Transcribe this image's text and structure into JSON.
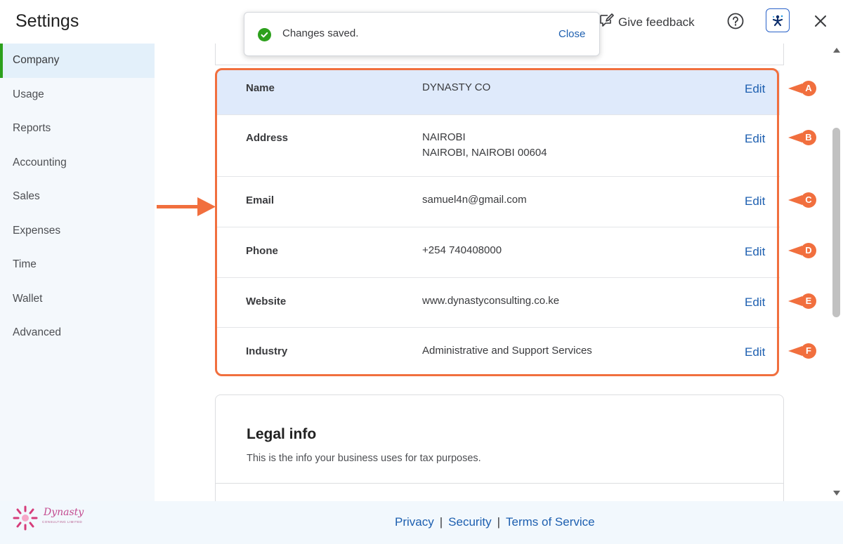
{
  "header": {
    "title": "Settings",
    "feedback_label": "Give feedback"
  },
  "toast": {
    "message": "Changes saved.",
    "close_label": "Close"
  },
  "sidebar": {
    "items": [
      {
        "label": "Company",
        "active": true
      },
      {
        "label": "Usage"
      },
      {
        "label": "Reports"
      },
      {
        "label": "Accounting"
      },
      {
        "label": "Sales"
      },
      {
        "label": "Expenses"
      },
      {
        "label": "Time"
      },
      {
        "label": "Wallet"
      },
      {
        "label": "Advanced"
      }
    ]
  },
  "company": {
    "edit_label": "Edit",
    "rows": [
      {
        "label": "Name",
        "value": "DYNASTY CO",
        "callout": "A"
      },
      {
        "label": "Address",
        "value_line1": "NAIROBI",
        "value_line2": "NAIROBI, NAIROBI 00604",
        "callout": "B"
      },
      {
        "label": "Email",
        "value": "samuel4n@gmail.com",
        "callout": "C"
      },
      {
        "label": "Phone",
        "value": "+254 740408000",
        "callout": "D"
      },
      {
        "label": "Website",
        "value": "www.dynastyconsulting.co.ke",
        "callout": "E"
      },
      {
        "label": "Industry",
        "value": "Administrative and Support Services",
        "callout": "F"
      }
    ]
  },
  "legal": {
    "title": "Legal info",
    "description": "This is the info your business uses for tax purposes."
  },
  "footer": {
    "links": [
      "Privacy",
      "Security",
      "Terms of Service"
    ],
    "separator": "|"
  },
  "logo": {
    "name": "Dynasty",
    "tagline": "CONSULTING LIMITED"
  },
  "colors": {
    "accent": "#2ca01c",
    "link": "#1d5fb0",
    "annotation": "#f16f3e",
    "highlight_row": "#dfeafb"
  },
  "icons": {
    "feedback": "feedback-pencil-icon",
    "help": "help-circle-icon",
    "assistant": "assistant-icon",
    "close": "close-icon",
    "success": "check-circle-icon"
  }
}
